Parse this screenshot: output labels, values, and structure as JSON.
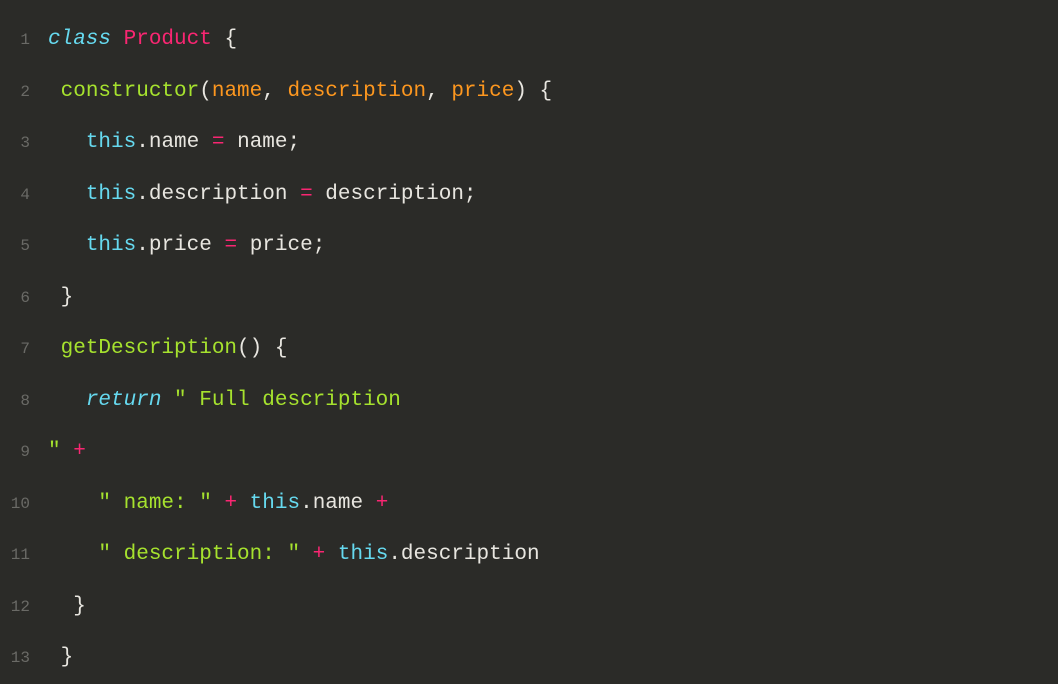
{
  "code": {
    "language": "javascript",
    "lines": [
      {
        "num": 1,
        "indent": "",
        "tokens": [
          {
            "cls": "tok-keyword",
            "t": "class"
          },
          {
            "cls": "tok-punct",
            "t": " "
          },
          {
            "cls": "tok-classname",
            "t": "Product"
          },
          {
            "cls": "tok-punct",
            "t": " {"
          }
        ]
      },
      {
        "num": 2,
        "indent": " ",
        "tokens": [
          {
            "cls": "tok-func",
            "t": "constructor"
          },
          {
            "cls": "tok-punct",
            "t": "("
          },
          {
            "cls": "tok-param",
            "t": "name"
          },
          {
            "cls": "tok-punct",
            "t": ", "
          },
          {
            "cls": "tok-param",
            "t": "description"
          },
          {
            "cls": "tok-punct",
            "t": ", "
          },
          {
            "cls": "tok-param",
            "t": "price"
          },
          {
            "cls": "tok-punct",
            "t": ") {"
          }
        ]
      },
      {
        "num": 3,
        "indent": "   ",
        "tokens": [
          {
            "cls": "tok-this",
            "t": "this"
          },
          {
            "cls": "tok-punct",
            "t": "."
          },
          {
            "cls": "tok-prop",
            "t": "name"
          },
          {
            "cls": "tok-punct",
            "t": " "
          },
          {
            "cls": "tok-op",
            "t": "="
          },
          {
            "cls": "tok-punct",
            "t": " "
          },
          {
            "cls": "tok-ident",
            "t": "name"
          },
          {
            "cls": "tok-punct",
            "t": ";"
          }
        ]
      },
      {
        "num": 4,
        "indent": "   ",
        "tokens": [
          {
            "cls": "tok-this",
            "t": "this"
          },
          {
            "cls": "tok-punct",
            "t": "."
          },
          {
            "cls": "tok-prop",
            "t": "description"
          },
          {
            "cls": "tok-punct",
            "t": " "
          },
          {
            "cls": "tok-op",
            "t": "="
          },
          {
            "cls": "tok-punct",
            "t": " "
          },
          {
            "cls": "tok-ident",
            "t": "description"
          },
          {
            "cls": "tok-punct",
            "t": ";"
          }
        ]
      },
      {
        "num": 5,
        "indent": "   ",
        "tokens": [
          {
            "cls": "tok-this",
            "t": "this"
          },
          {
            "cls": "tok-punct",
            "t": "."
          },
          {
            "cls": "tok-prop",
            "t": "price"
          },
          {
            "cls": "tok-punct",
            "t": " "
          },
          {
            "cls": "tok-op",
            "t": "="
          },
          {
            "cls": "tok-punct",
            "t": " "
          },
          {
            "cls": "tok-ident",
            "t": "price"
          },
          {
            "cls": "tok-punct",
            "t": ";"
          }
        ]
      },
      {
        "num": 6,
        "indent": " ",
        "tokens": [
          {
            "cls": "tok-punct",
            "t": "}"
          }
        ]
      },
      {
        "num": 7,
        "indent": " ",
        "tokens": [
          {
            "cls": "tok-func",
            "t": "getDescription"
          },
          {
            "cls": "tok-punct",
            "t": "() {"
          }
        ]
      },
      {
        "num": 8,
        "indent": "   ",
        "tokens": [
          {
            "cls": "tok-keyword",
            "t": "return"
          },
          {
            "cls": "tok-punct",
            "t": " "
          },
          {
            "cls": "tok-string",
            "t": "\" Full description"
          }
        ]
      },
      {
        "num": 9,
        "indent": "",
        "tokens": [
          {
            "cls": "tok-string",
            "t": "\""
          },
          {
            "cls": "tok-punct",
            "t": " "
          },
          {
            "cls": "tok-op",
            "t": "+"
          }
        ]
      },
      {
        "num": 10,
        "indent": "    ",
        "tokens": [
          {
            "cls": "tok-string",
            "t": "\" name: \""
          },
          {
            "cls": "tok-punct",
            "t": " "
          },
          {
            "cls": "tok-op",
            "t": "+"
          },
          {
            "cls": "tok-punct",
            "t": " "
          },
          {
            "cls": "tok-this",
            "t": "this"
          },
          {
            "cls": "tok-punct",
            "t": "."
          },
          {
            "cls": "tok-prop",
            "t": "name"
          },
          {
            "cls": "tok-punct",
            "t": " "
          },
          {
            "cls": "tok-op",
            "t": "+"
          }
        ]
      },
      {
        "num": 11,
        "indent": "    ",
        "tokens": [
          {
            "cls": "tok-string",
            "t": "\" description: \""
          },
          {
            "cls": "tok-punct",
            "t": " "
          },
          {
            "cls": "tok-op",
            "t": "+"
          },
          {
            "cls": "tok-punct",
            "t": " "
          },
          {
            "cls": "tok-this",
            "t": "this"
          },
          {
            "cls": "tok-punct",
            "t": "."
          },
          {
            "cls": "tok-prop",
            "t": "description"
          }
        ]
      },
      {
        "num": 12,
        "indent": "  ",
        "tokens": [
          {
            "cls": "tok-punct",
            "t": "}"
          }
        ]
      },
      {
        "num": 13,
        "indent": " ",
        "tokens": [
          {
            "cls": "tok-punct",
            "t": "}"
          }
        ]
      }
    ]
  }
}
